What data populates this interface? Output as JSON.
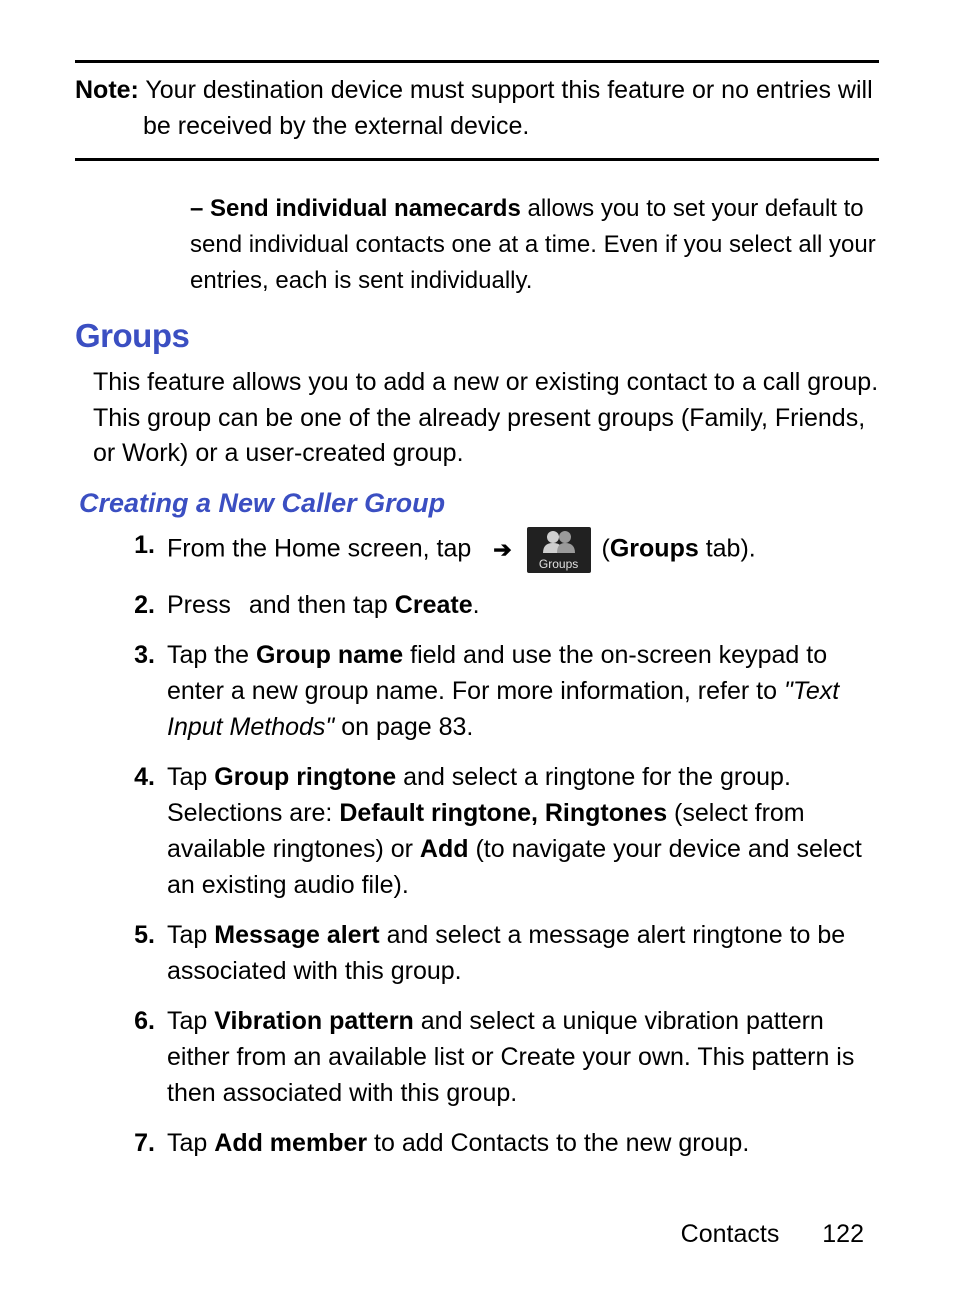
{
  "note": {
    "label": "Note:",
    "text": "Your destination device must support this feature or no entries will be received by the external device."
  },
  "bullet": {
    "dash": "–",
    "bold": "Send individual namecards",
    "rest": " allows you to set your default to send individual contacts one at a time. Even if you select all your entries, each is sent individually."
  },
  "heading": "Groups",
  "intro": "This feature allows you to add a new or existing contact to a call group. This group can be one of the already present groups (Family, Friends, or Work) or a user-created group.",
  "subheading": "Creating a New Caller Group",
  "steps": {
    "s1": {
      "pre": "From the Home screen, tap ",
      "arrow": "➔",
      "groups_label": "Groups",
      "paren_open": " (",
      "groups_bold": "Groups",
      "tab_text": " tab)."
    },
    "s2": {
      "pre": "Press ",
      "mid": " and then tap ",
      "create": "Create",
      "end": "."
    },
    "s3": {
      "pre": "Tap the ",
      "bold1": "Group name",
      "mid": " field and use the on-screen keypad to enter a new group name. For more information, refer to ",
      "italic": "\"Text Input Methods\"",
      "end": "  on page 83."
    },
    "s4": {
      "pre": "Tap ",
      "bold1": "Group ringtone",
      "mid1": " and select a ringtone for the group. Selections are: ",
      "bold2": "Default ringtone, Ringtones",
      "mid2": " (select from available ringtones) or ",
      "bold3": "Add",
      "end": " (to navigate your device and select an existing audio file)."
    },
    "s5": {
      "pre": "Tap ",
      "bold1": "Message alert",
      "end": " and select a message alert ringtone to be associated with this group."
    },
    "s6": {
      "pre": "Tap ",
      "bold1": "Vibration pattern",
      "end": " and select a unique vibration pattern either from an available list or Create your own. This pattern is then associated with this group."
    },
    "s7": {
      "pre": "Tap ",
      "bold1": "Add member",
      "end": " to add Contacts to the new group."
    }
  },
  "footer": {
    "section": "Contacts",
    "page": "122"
  }
}
